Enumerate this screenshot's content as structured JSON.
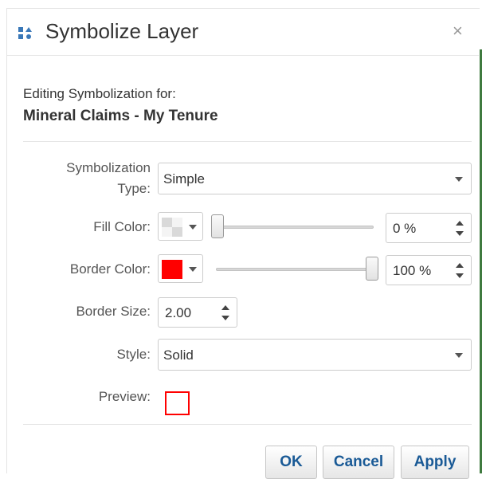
{
  "dialog": {
    "title": "Symbolize Layer",
    "close_glyph": "×",
    "editing_label": "Editing Symbolization for:",
    "layer_name": "Mineral Claims - My Tenure"
  },
  "form": {
    "symbolization_type": {
      "label_line1": "Symbolization",
      "label_line2": "Type:",
      "value": "Simple"
    },
    "fill_color": {
      "label": "Fill Color:",
      "swatch": "transparent-checker",
      "opacity_value": "0 %",
      "opacity_level": 0
    },
    "border_color": {
      "label": "Border Color:",
      "swatch": "#ff0000",
      "opacity_value": "100 %",
      "opacity_level": 100
    },
    "border_size": {
      "label": "Border Size:",
      "value": "2.00"
    },
    "style": {
      "label": "Style:",
      "value": "Solid"
    },
    "preview": {
      "label": "Preview:",
      "border_color": "#ff0000"
    }
  },
  "buttons": {
    "ok": "OK",
    "cancel": "Cancel",
    "apply": "Apply"
  },
  "colors": {
    "accent_text": "#1a5a96",
    "green_edge": "#3f7a3f"
  },
  "icons": {
    "title": "layer-symbol-icon",
    "close": "close-icon"
  }
}
